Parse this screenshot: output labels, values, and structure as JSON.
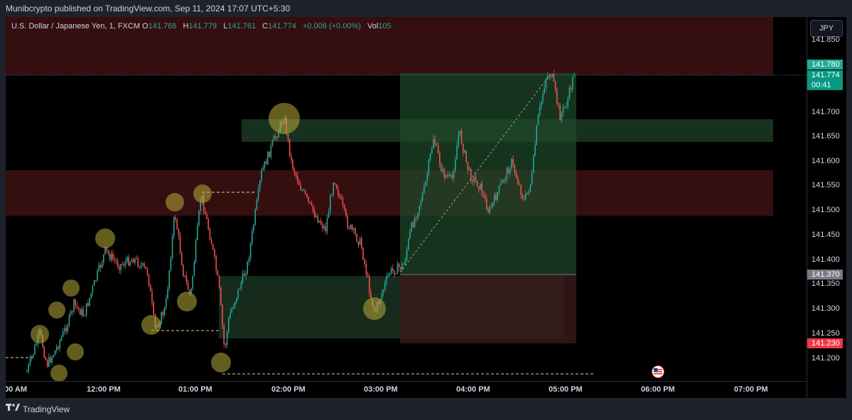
{
  "publish_line": "Munibcrypto published on TradingView.com, Sep 11, 2024 17:07 UTC+5:30",
  "legend": {
    "symbol": "U.S. Dollar / Japanese Yen, 1, FXCM",
    "o_label": "O",
    "o_value": "141.768",
    "h_label": "H",
    "h_value": "141.779",
    "l_label": "L",
    "l_value": "141.761",
    "c_label": "C",
    "c_value": "141.774",
    "change": "+0.006 (+0.00%)",
    "vol_label": "Vol",
    "vol_value": "105"
  },
  "currency_button": "JPY",
  "price_axis": {
    "ticks": [
      "141.850",
      "141.700",
      "141.650",
      "141.600",
      "141.550",
      "141.500",
      "141.450",
      "141.400",
      "141.350",
      "141.300",
      "141.250",
      "141.200"
    ],
    "tag_target": "141.780",
    "tag_current": "141.774",
    "tag_countdown": "00:41",
    "tag_entry": "141.370",
    "tag_stop": "141.230"
  },
  "time_axis": [
    "00 AM",
    "12:00 PM",
    "01:00 PM",
    "02:00 PM",
    "03:00 PM",
    "04:00 PM",
    "05:00 PM",
    "06:00 PM",
    "07:00 PM"
  ],
  "footer_brand": "TradingView",
  "colors": {
    "up": "#26a69a",
    "down": "#ef5350",
    "target_tag": "#22ab94",
    "current_tag": "#089981",
    "entry_tag": "#787b86",
    "stop_tag": "#f23645"
  },
  "icons": [
    "tv-logo-icon",
    "us-flag-event-icon"
  ]
}
